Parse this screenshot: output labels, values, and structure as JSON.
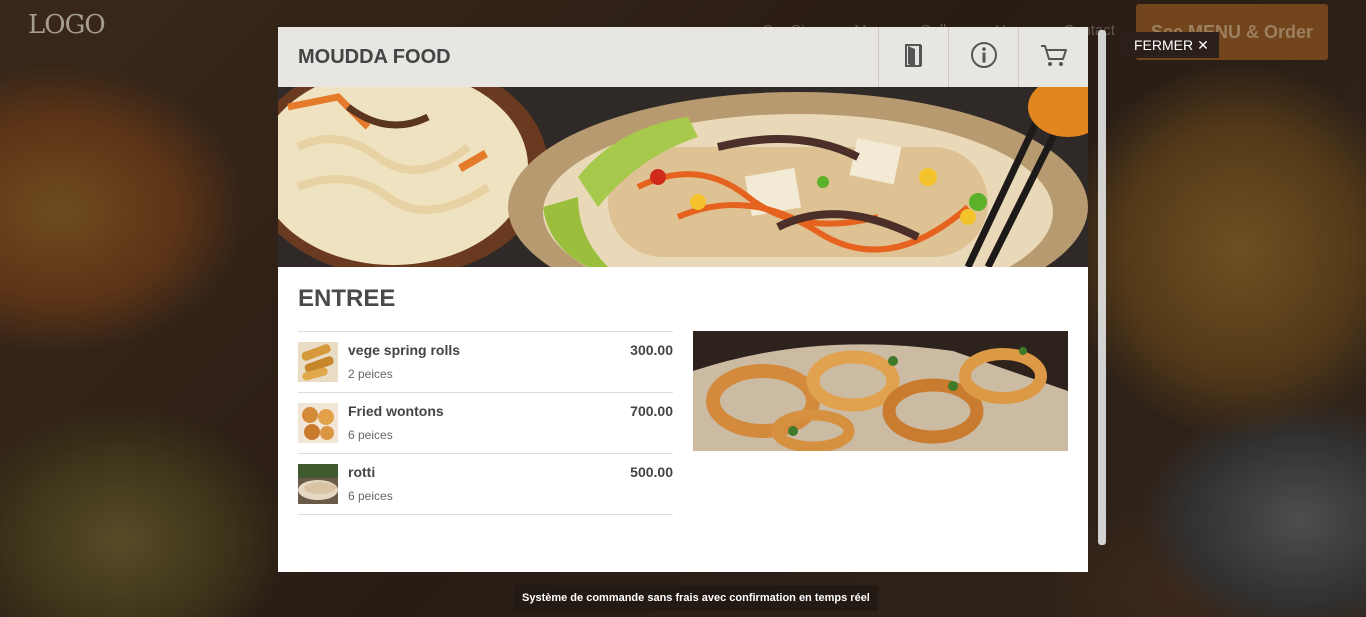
{
  "site": {
    "logo_text": "LOGO",
    "nav": [
      "Our Story",
      "Menu",
      "Gallery",
      "Hours",
      "Contact"
    ],
    "order_button": "See MENU & Order",
    "close_label": "FERMER",
    "close_icon": "close-icon"
  },
  "modal": {
    "brand": "MOUDDA FOOD",
    "header_icons": [
      "door-exit-icon",
      "info-icon",
      "cart-icon"
    ],
    "section_title": "ENTREE",
    "items": [
      {
        "name": "vege spring rolls",
        "desc": "2 peices",
        "price": "300.00"
      },
      {
        "name": "Fried wontons",
        "desc": "6 peices",
        "price": "700.00"
      },
      {
        "name": "rotti",
        "desc": "6 peices",
        "price": "500.00"
      }
    ]
  },
  "footer": {
    "tooltip": "Système de commande sans frais avec confirmation en temps réel"
  },
  "colors": {
    "modal_header_bg": "#e8e6e3",
    "order_button_bg": "#7a4a1e",
    "tooltip_bg": "#231a14"
  }
}
